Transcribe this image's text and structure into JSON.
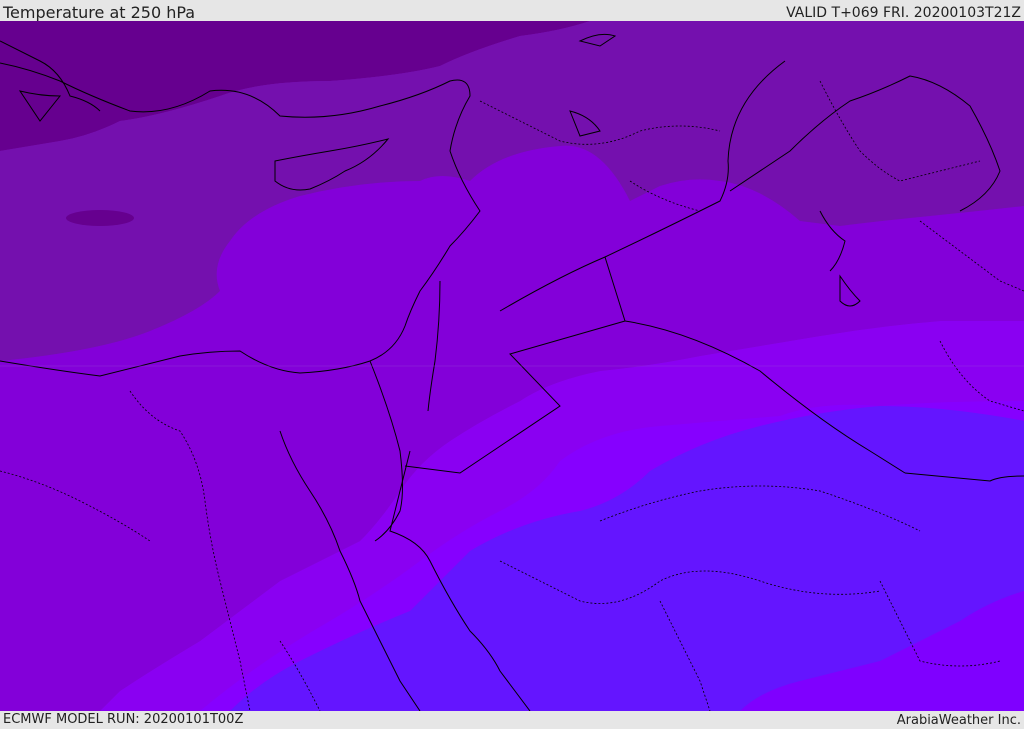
{
  "header": {
    "title": "Temperature at 250 hPa",
    "valid_time": "VALID T+069 FRI. 20200103T21Z"
  },
  "footer": {
    "model_run": "ECMWF MODEL RUN: 20200101T00Z",
    "credit": "ArabiaWeather Inc."
  },
  "map": {
    "palette": {
      "level_1": "#66008f",
      "level_2": "#7410ae",
      "level_3": "#7d0fb3",
      "level_4": "#8300d9",
      "level_5": "#8a00f2",
      "level_6": "#8600ff",
      "level_7": "#6415ff",
      "border_color": "#000000"
    }
  }
}
